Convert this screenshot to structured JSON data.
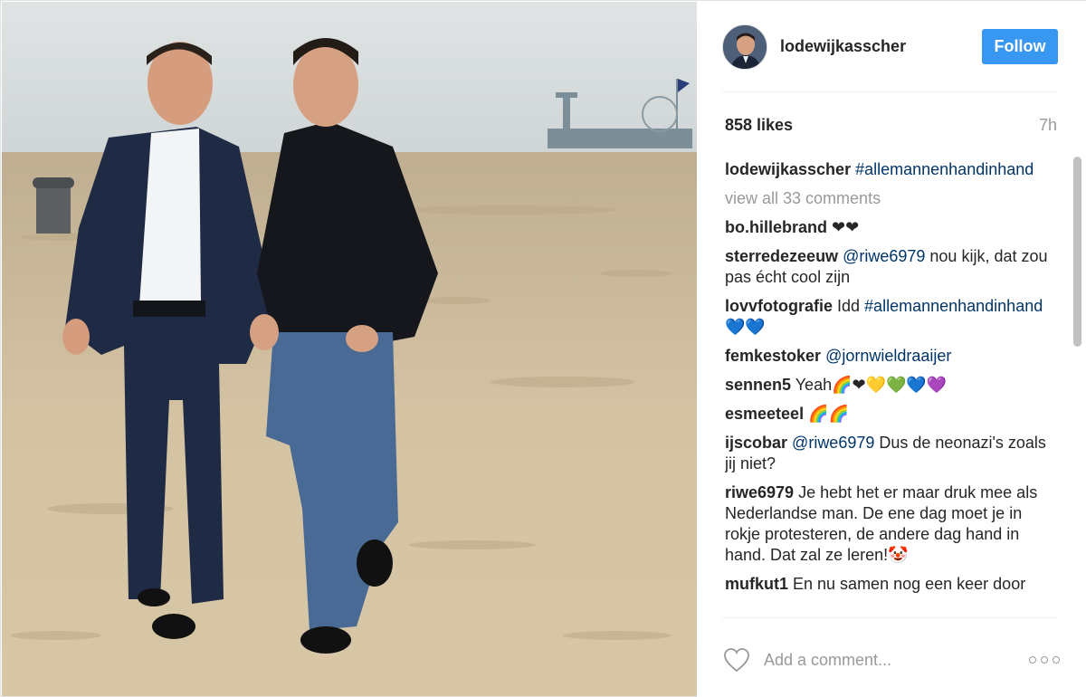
{
  "post": {
    "username": "lodewijkasscher",
    "follow_label": "Follow",
    "likes_text": "858 likes",
    "time_ago": "7h",
    "view_all": "view all 33 comments",
    "add_comment_placeholder": "Add a comment...",
    "accent_color": "#3897f0",
    "hashtag_color": "#003569"
  },
  "caption": {
    "user": "lodewijkasscher",
    "text": "#allemannenhandinhand"
  },
  "comments": [
    {
      "user": "bo.hillebrand",
      "text": "❤❤"
    },
    {
      "user": "sterredezeeuw",
      "mention": "@riwe6979",
      "text": " nou kijk, dat zou pas écht cool zijn"
    },
    {
      "user": "lovvfotografie",
      "text": " Idd ",
      "tag": "#allemannenhandinhand",
      "emoji": "💙💙"
    },
    {
      "user": "femkestoker",
      "mention": "@jornwieldraaijer",
      "text": ""
    },
    {
      "user": "sennen5",
      "text": " Yeah🌈❤💛💚💙💜"
    },
    {
      "user": "esmeeteel",
      "text": " 🌈🌈"
    },
    {
      "user": "ijscobar",
      "mention": "@riwe6979",
      "text": " Dus de neonazi's zoals jij niet?"
    },
    {
      "user": "riwe6979",
      "text": " Je hebt het er maar druk mee als Nederlandse man. De ene dag moet je in rokje protesteren, de andere dag hand in hand. Dat zal ze leren!🤡"
    },
    {
      "user": "mufkut1",
      "text": " En nu samen nog een keer door"
    }
  ],
  "icons": {
    "heart": "heart-outline-icon",
    "more": "more-options-icon"
  }
}
